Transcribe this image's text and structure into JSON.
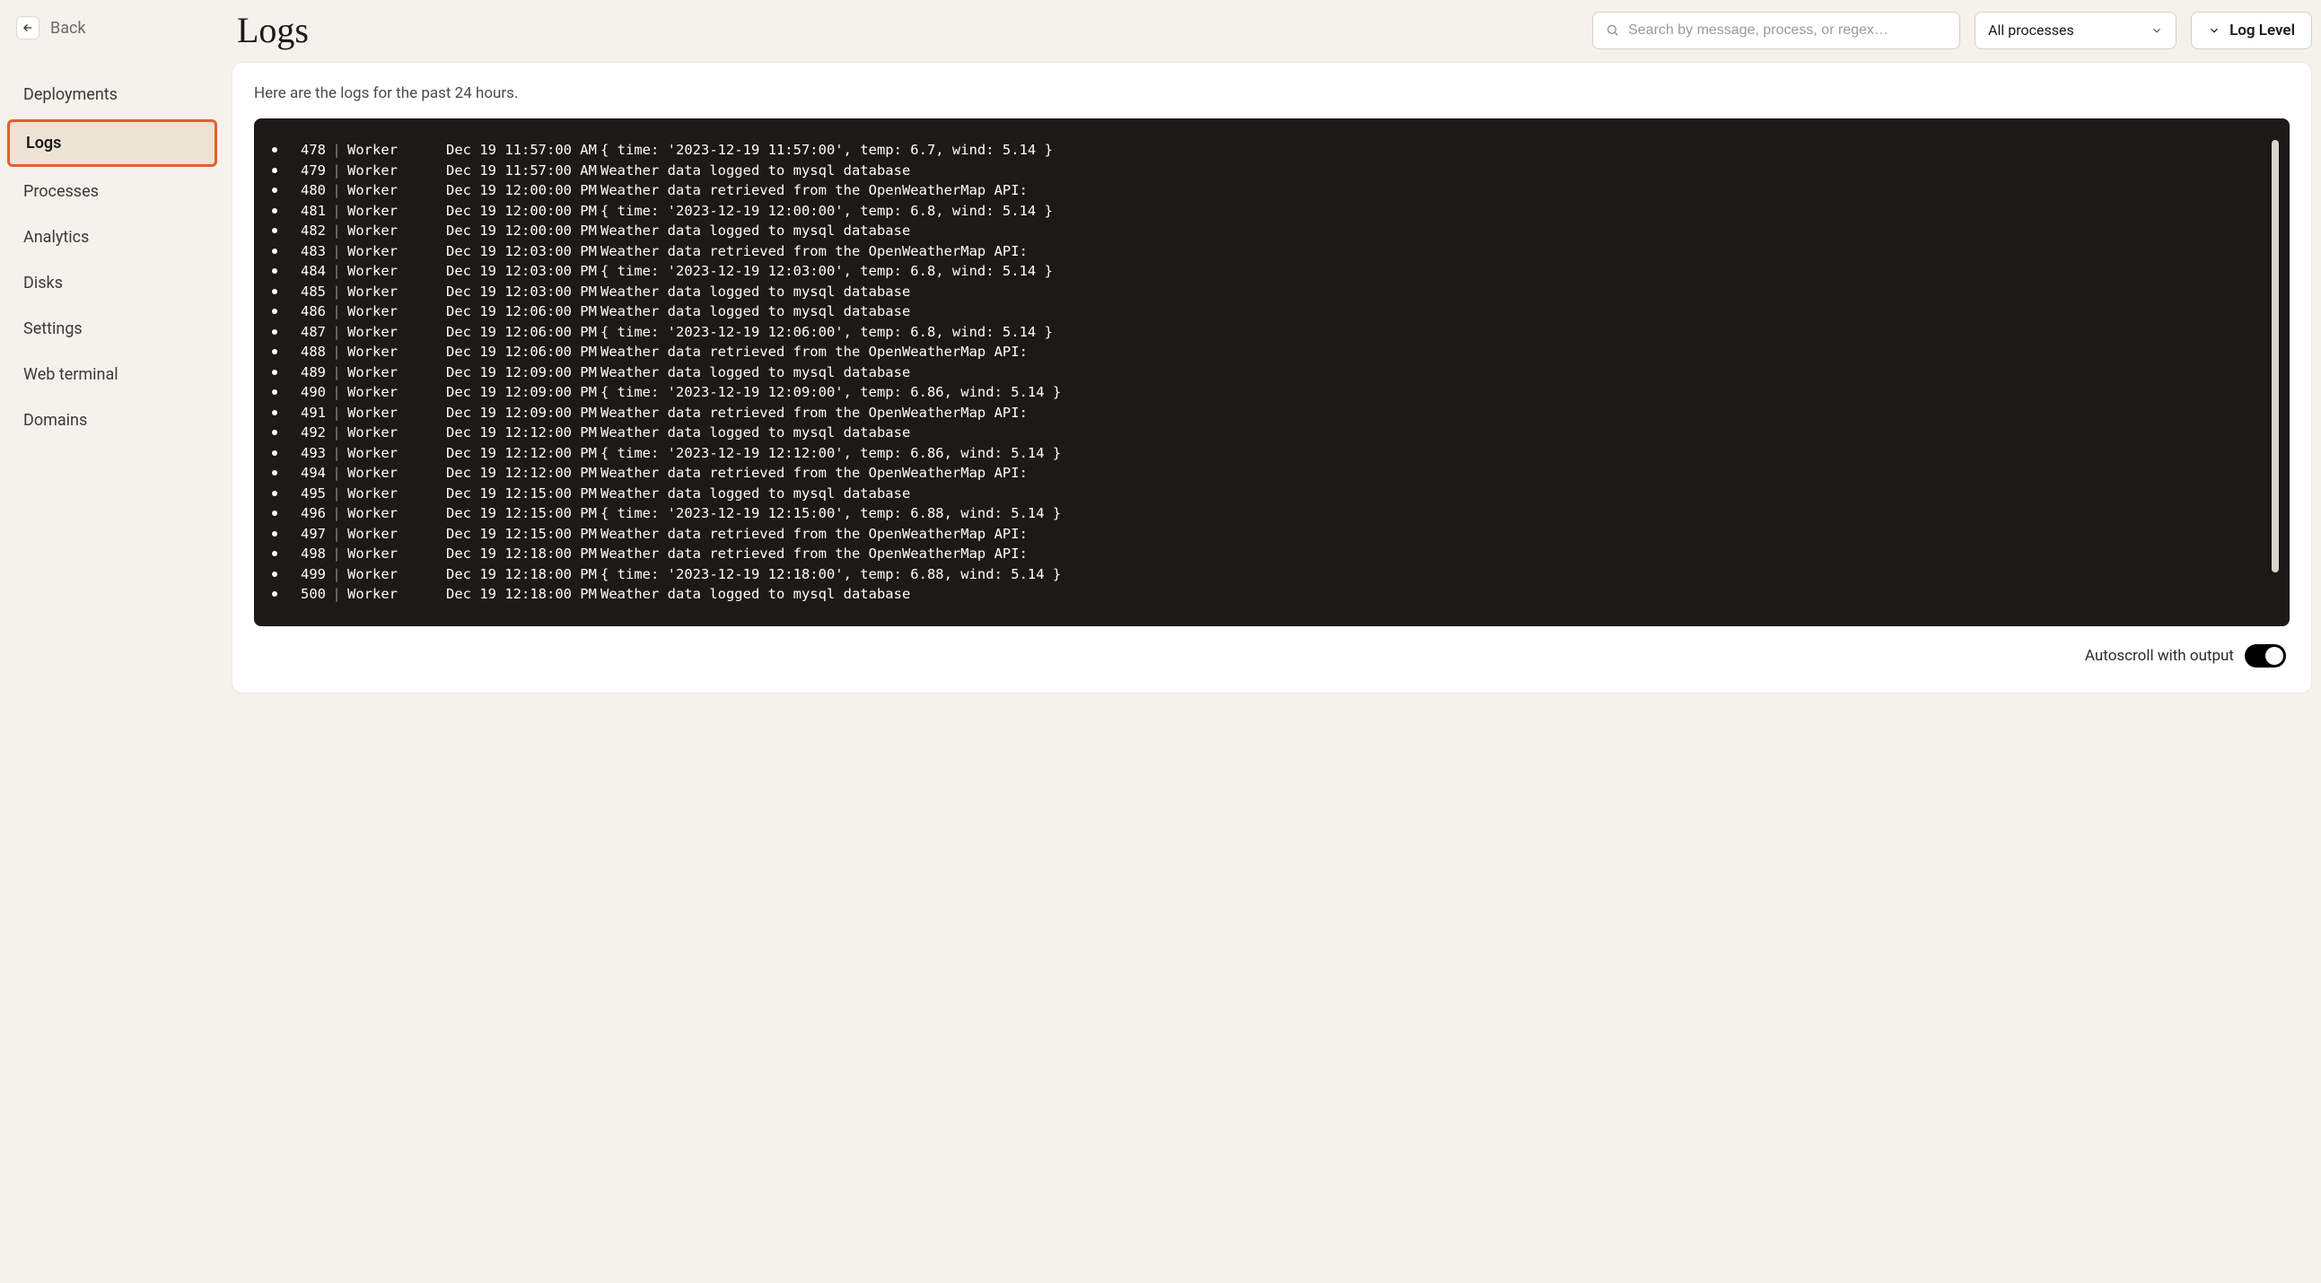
{
  "back_label": "Back",
  "page_title": "Logs",
  "search_placeholder": "Search by message, process, or regex…",
  "process_filter": "All processes",
  "loglevel_label": "Log Level",
  "info_text": "Here are the logs for the past 24 hours.",
  "autoscroll_label": "Autoscroll with output",
  "sidebar": {
    "items": [
      {
        "label": "Deployments",
        "active": false
      },
      {
        "label": "Logs",
        "active": true
      },
      {
        "label": "Processes",
        "active": false
      },
      {
        "label": "Analytics",
        "active": false
      },
      {
        "label": "Disks",
        "active": false
      },
      {
        "label": "Settings",
        "active": false
      },
      {
        "label": "Web terminal",
        "active": false
      },
      {
        "label": "Domains",
        "active": false
      }
    ]
  },
  "logs": [
    {
      "num": "478",
      "proc": "Worker",
      "ts": "Dec 19 11:57:00 AM",
      "msg": "{ time: '2023-12-19 11:57:00', temp: 6.7, wind: 5.14 }"
    },
    {
      "num": "479",
      "proc": "Worker",
      "ts": "Dec 19 11:57:00 AM",
      "msg": "Weather data logged to mysql database"
    },
    {
      "num": "480",
      "proc": "Worker",
      "ts": "Dec 19 12:00:00 PM",
      "msg": "Weather data retrieved from the OpenWeatherMap API:"
    },
    {
      "num": "481",
      "proc": "Worker",
      "ts": "Dec 19 12:00:00 PM",
      "msg": "{ time: '2023-12-19 12:00:00', temp: 6.8, wind: 5.14 }"
    },
    {
      "num": "482",
      "proc": "Worker",
      "ts": "Dec 19 12:00:00 PM",
      "msg": "Weather data logged to mysql database"
    },
    {
      "num": "483",
      "proc": "Worker",
      "ts": "Dec 19 12:03:00 PM",
      "msg": "Weather data retrieved from the OpenWeatherMap API:"
    },
    {
      "num": "484",
      "proc": "Worker",
      "ts": "Dec 19 12:03:00 PM",
      "msg": "{ time: '2023-12-19 12:03:00', temp: 6.8, wind: 5.14 }"
    },
    {
      "num": "485",
      "proc": "Worker",
      "ts": "Dec 19 12:03:00 PM",
      "msg": "Weather data logged to mysql database"
    },
    {
      "num": "486",
      "proc": "Worker",
      "ts": "Dec 19 12:06:00 PM",
      "msg": "Weather data logged to mysql database"
    },
    {
      "num": "487",
      "proc": "Worker",
      "ts": "Dec 19 12:06:00 PM",
      "msg": "{ time: '2023-12-19 12:06:00', temp: 6.8, wind: 5.14 }"
    },
    {
      "num": "488",
      "proc": "Worker",
      "ts": "Dec 19 12:06:00 PM",
      "msg": "Weather data retrieved from the OpenWeatherMap API:"
    },
    {
      "num": "489",
      "proc": "Worker",
      "ts": "Dec 19 12:09:00 PM",
      "msg": "Weather data logged to mysql database"
    },
    {
      "num": "490",
      "proc": "Worker",
      "ts": "Dec 19 12:09:00 PM",
      "msg": "{ time: '2023-12-19 12:09:00', temp: 6.86, wind: 5.14 }"
    },
    {
      "num": "491",
      "proc": "Worker",
      "ts": "Dec 19 12:09:00 PM",
      "msg": "Weather data retrieved from the OpenWeatherMap API:"
    },
    {
      "num": "492",
      "proc": "Worker",
      "ts": "Dec 19 12:12:00 PM",
      "msg": "Weather data logged to mysql database"
    },
    {
      "num": "493",
      "proc": "Worker",
      "ts": "Dec 19 12:12:00 PM",
      "msg": "{ time: '2023-12-19 12:12:00', temp: 6.86, wind: 5.14 }"
    },
    {
      "num": "494",
      "proc": "Worker",
      "ts": "Dec 19 12:12:00 PM",
      "msg": "Weather data retrieved from the OpenWeatherMap API:"
    },
    {
      "num": "495",
      "proc": "Worker",
      "ts": "Dec 19 12:15:00 PM",
      "msg": "Weather data logged to mysql database"
    },
    {
      "num": "496",
      "proc": "Worker",
      "ts": "Dec 19 12:15:00 PM",
      "msg": "{ time: '2023-12-19 12:15:00', temp: 6.88, wind: 5.14 }"
    },
    {
      "num": "497",
      "proc": "Worker",
      "ts": "Dec 19 12:15:00 PM",
      "msg": "Weather data retrieved from the OpenWeatherMap API:"
    },
    {
      "num": "498",
      "proc": "Worker",
      "ts": "Dec 19 12:18:00 PM",
      "msg": "Weather data retrieved from the OpenWeatherMap API:"
    },
    {
      "num": "499",
      "proc": "Worker",
      "ts": "Dec 19 12:18:00 PM",
      "msg": "{ time: '2023-12-19 12:18:00', temp: 6.88, wind: 5.14 }"
    },
    {
      "num": "500",
      "proc": "Worker",
      "ts": "Dec 19 12:18:00 PM",
      "msg": "Weather data logged to mysql database"
    }
  ]
}
